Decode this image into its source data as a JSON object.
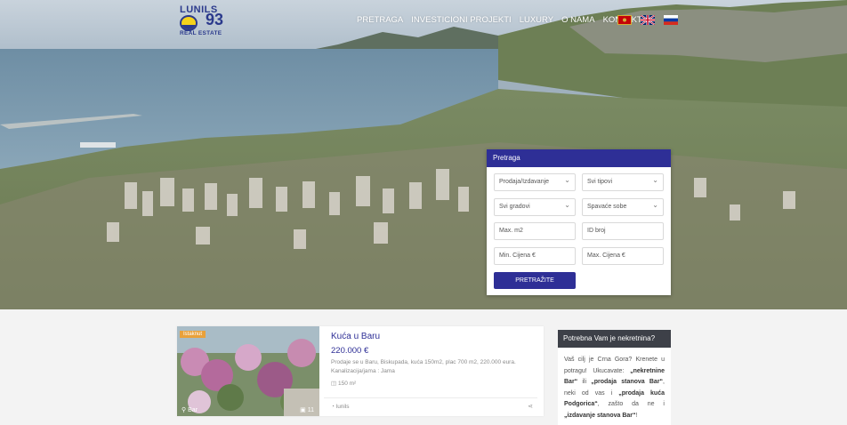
{
  "logo": {
    "brand": "LUNILS",
    "number": "93",
    "subtitle": "REAL ESTATE"
  },
  "nav": [
    "PRETRAGA",
    "INVESTICIONI PROJEKTI",
    "LUXURY",
    "O NAMA",
    "KONTAKT"
  ],
  "flags": [
    "flag-montenegro-icon",
    "flag-uk-icon",
    "flag-russia-icon"
  ],
  "search": {
    "title": "Pretraga",
    "type_select": "Prodaja/Izdavanje",
    "category_select": "Svi tipovi",
    "city_select": "Svi gradovi",
    "bedrooms_select": "Spavaće sobe",
    "max_m2_placeholder": "Max. m2",
    "id_placeholder": "ID broj",
    "min_price_placeholder": "Min. Cijena €",
    "max_price_placeholder": "Max. Cijena €",
    "button": "PRETRAŽITE"
  },
  "listing": {
    "badge": "Istaknut",
    "location": "Bar",
    "photo_count": "11",
    "title": "Kuća u Baru",
    "price": "220.000 €",
    "description": "Prodaje se u Baru, Biskupada, kuća 150m2, plac 700 m2, 220.000 eura. Kanalizacija/jama : Jama",
    "area": "150 m²",
    "agent": "lunils"
  },
  "sidebox": {
    "title": "Potrebna Vam je nekretnina?",
    "text_1": "Vaš cilj je Crna Gora? Krenete u potragu! Ukucavate: ",
    "kw1": "„nekretnine Bar“",
    "text_2": " ili ",
    "kw2": "„prodaja stanova Bar“",
    "text_3": ", neki od vas i ",
    "kw3": "„prodaja kuća Podgorica“",
    "text_4": ", zašto da ne i ",
    "kw4": "„izdavanje stanova Bar“",
    "text_5": "!"
  },
  "colors": {
    "brand_blue": "#2e2f96",
    "badge_orange": "#e9a13b",
    "sidebox_header": "#3d4048"
  }
}
